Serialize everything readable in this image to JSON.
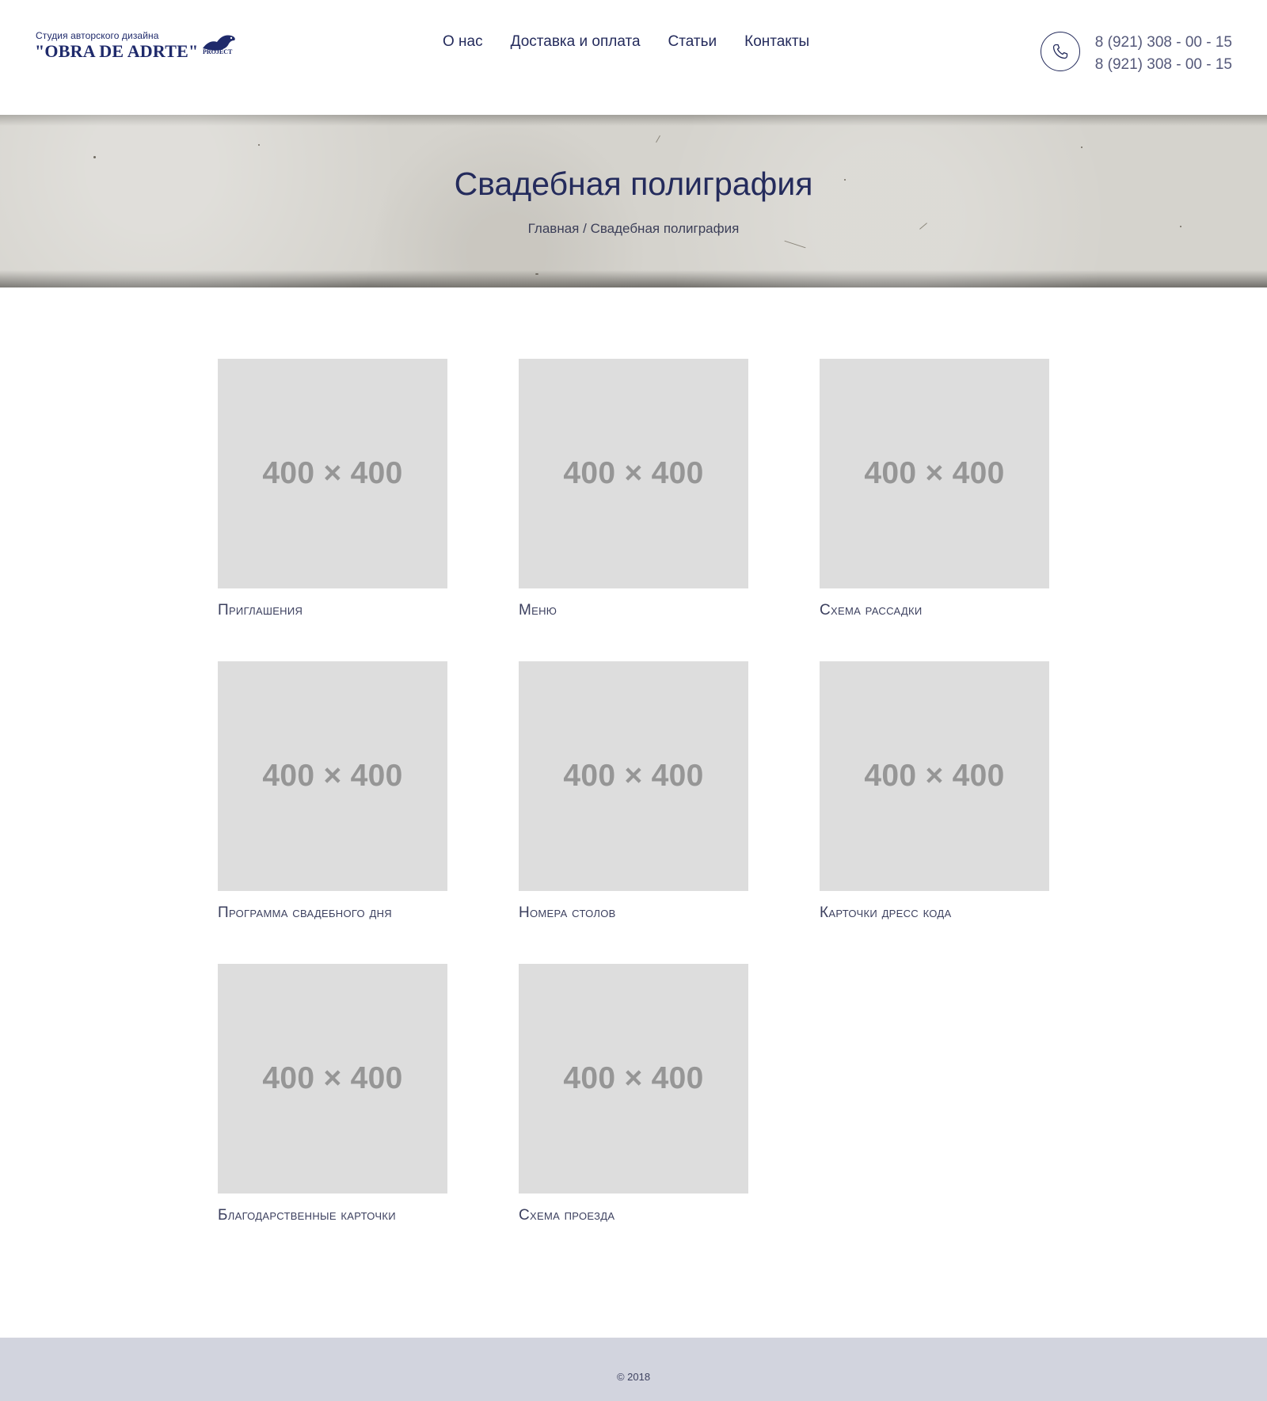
{
  "header": {
    "logo": {
      "tagline": "Студия авторского дизайна",
      "name": "\"OBRA DE ADRTE\"",
      "suffix": "PROJECT"
    },
    "nav": [
      {
        "label": "О нас"
      },
      {
        "label": "Доставка и оплата"
      },
      {
        "label": "Статьи"
      },
      {
        "label": "Контакты"
      }
    ],
    "phone_icon": "phone-icon",
    "phones": [
      "8 (921) 308 - 00 - 15",
      "8 (921) 308 - 00 - 15"
    ]
  },
  "banner": {
    "title": "Свадебная полиграфия",
    "breadcrumb": {
      "home": "Главная",
      "separator": " / ",
      "current": "Свадебная полиграфия"
    }
  },
  "catalog": {
    "items": [
      {
        "placeholder": "400 × 400",
        "title": "Приглашения"
      },
      {
        "placeholder": "400 × 400",
        "title": "Меню"
      },
      {
        "placeholder": "400 × 400",
        "title": "Схема рассадки"
      },
      {
        "placeholder": "400 × 400",
        "title": "Программа свадебного дня"
      },
      {
        "placeholder": "400 × 400",
        "title": "Номера столов"
      },
      {
        "placeholder": "400 × 400",
        "title": "Карточки дресс кода"
      },
      {
        "placeholder": "400 × 400",
        "title": "Благодарственные карточки"
      },
      {
        "placeholder": "400 × 400",
        "title": "Схема проезда"
      }
    ]
  },
  "footer": {
    "copyright": "© 2018"
  },
  "colors": {
    "brand": "#242b5c",
    "placeholder_bg": "#dddddd",
    "placeholder_text": "#969696",
    "footer_bg": "#d2d4de",
    "banner_bg": "#d5d3cd"
  }
}
